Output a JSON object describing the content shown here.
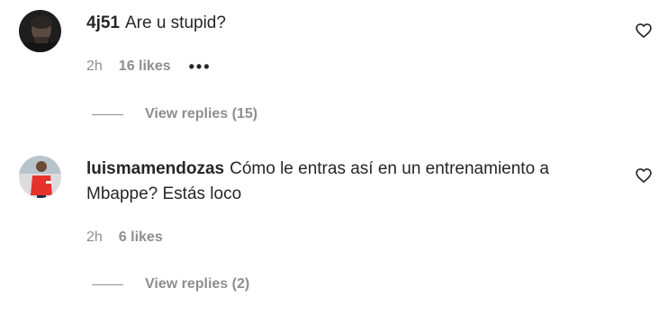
{
  "comments": [
    {
      "username": "4j51",
      "text": "Are u stupid?",
      "time": "2h",
      "likes": "16 likes",
      "more": "•••",
      "view_replies": "View replies (15)"
    },
    {
      "username": "luismamendozas",
      "text": "Cómo le entras así en un entrenamiento a Mbappe? Estás loco",
      "time": "2h",
      "likes": "6 likes",
      "view_replies": "View replies (2)"
    }
  ],
  "colors": {
    "text": "#262626",
    "secondary": "#8e8e8e",
    "avatar1_bg": "#1e1e1e",
    "avatar2_bg": "#dcdcdc",
    "avatar2_shirt": "#e5322d"
  },
  "icons": {
    "like": "heart-outline-icon",
    "more": "more-options-icon"
  }
}
